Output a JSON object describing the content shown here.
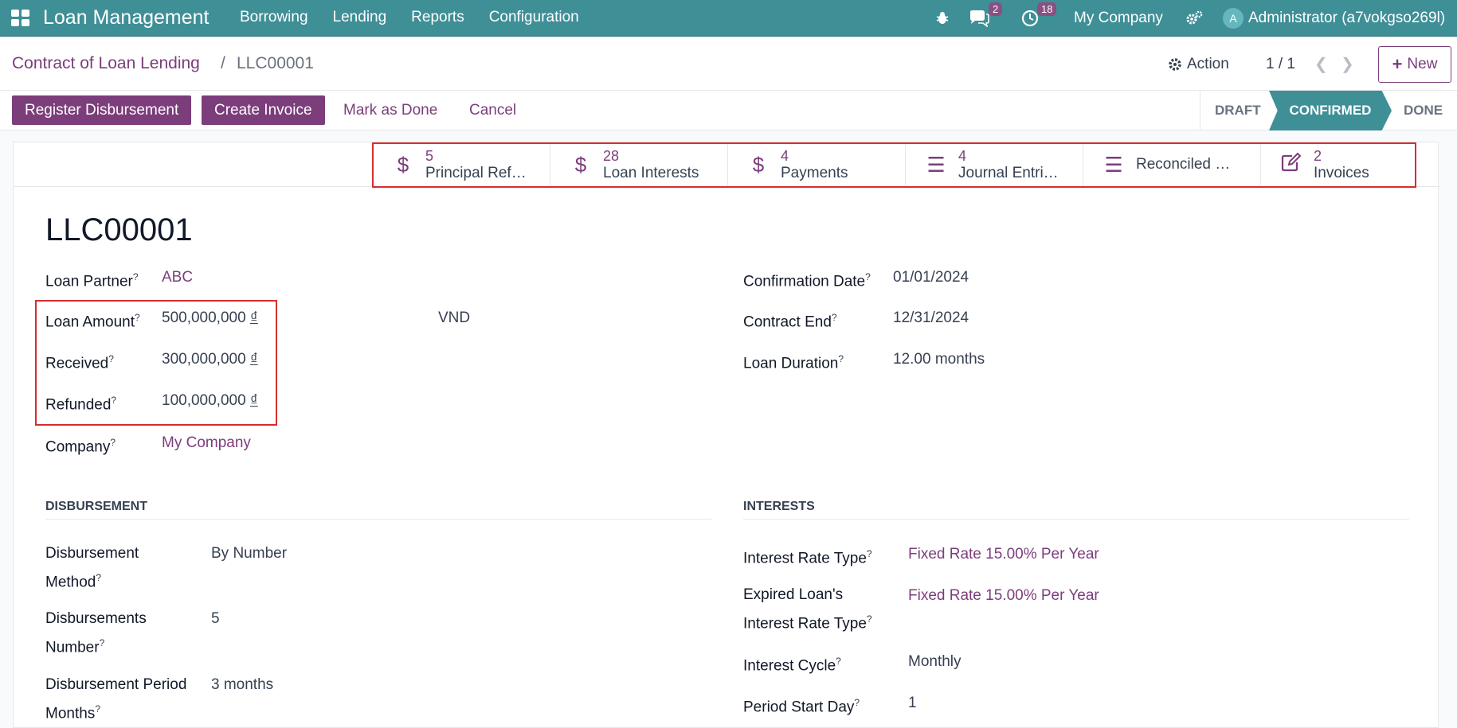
{
  "topbar": {
    "app_title": "Loan Management",
    "menu": [
      "Borrowing",
      "Lending",
      "Reports",
      "Configuration"
    ],
    "messages_count": "2",
    "activities_count": "18",
    "company": "My Company",
    "avatar_letter": "A",
    "user": "Administrator (a7vokgso269l)"
  },
  "control": {
    "breadcrumb_parent": "Contract of Loan Lending",
    "breadcrumb_sep": "/",
    "breadcrumb_current": "LLC00001",
    "action_label": "Action",
    "pager": "1 / 1",
    "new_label": "New"
  },
  "statusbar": {
    "register_disbursement": "Register Disbursement",
    "create_invoice": "Create Invoice",
    "mark_as_done": "Mark as Done",
    "cancel": "Cancel",
    "stages": {
      "draft": "DRAFT",
      "confirmed": "CONFIRMED",
      "done": "DONE"
    },
    "current_stage": "CONFIRMED"
  },
  "smart_buttons": [
    {
      "icon": "dollar-icon",
      "count": "5",
      "label": "Principal Ref…"
    },
    {
      "icon": "dollar-icon",
      "count": "28",
      "label": "Loan Interests"
    },
    {
      "icon": "dollar-icon",
      "count": "4",
      "label": "Payments"
    },
    {
      "icon": "list-icon",
      "count": "4",
      "label": "Journal Entri…"
    },
    {
      "icon": "list-icon",
      "count": "",
      "label": "Reconciled …"
    },
    {
      "icon": "edit-icon",
      "count": "2",
      "label": "Invoices"
    }
  ],
  "record": {
    "name": "LLC00001",
    "loan_partner_label": "Loan Partner",
    "loan_partner": "ABC",
    "loan_amount_label": "Loan Amount",
    "loan_amount": "500,000,000",
    "received_label": "Received",
    "received": "300,000,000",
    "refunded_label": "Refunded",
    "refunded": "100,000,000",
    "currency_symbol": "₫",
    "currency": "VND",
    "company_label": "Company",
    "company": "My Company",
    "confirmation_date_label": "Confirmation Date",
    "confirmation_date": "01/01/2024",
    "contract_end_label": "Contract End",
    "contract_end": "12/31/2024",
    "loan_duration_label": "Loan Duration",
    "loan_duration": "12.00 months",
    "help_mark": "?"
  },
  "disbursement": {
    "title": "DISBURSEMENT",
    "method_label_1": "Disbursement",
    "method_label_2": "Method",
    "method": "By Number",
    "number_label_1": "Disbursements",
    "number_label_2": "Number",
    "number": "5",
    "period_label_1": "Disbursement Period",
    "period_label_2": "Months",
    "period": "3 months"
  },
  "interests": {
    "title": "INTERESTS",
    "rate_type_label": "Interest Rate Type",
    "rate_type": "Fixed Rate 15.00% Per Year",
    "expired_label_1": "Expired Loan's",
    "expired_label_2": "Interest Rate Type",
    "expired_rate_type": "Fixed Rate 15.00% Per Year",
    "cycle_label": "Interest Cycle",
    "cycle": "Monthly",
    "start_day_label": "Period Start Day",
    "start_day": "1"
  },
  "colors": {
    "brand": "#3f8f97",
    "accent": "#7c3d7b",
    "highlight": "#d62d2d"
  }
}
